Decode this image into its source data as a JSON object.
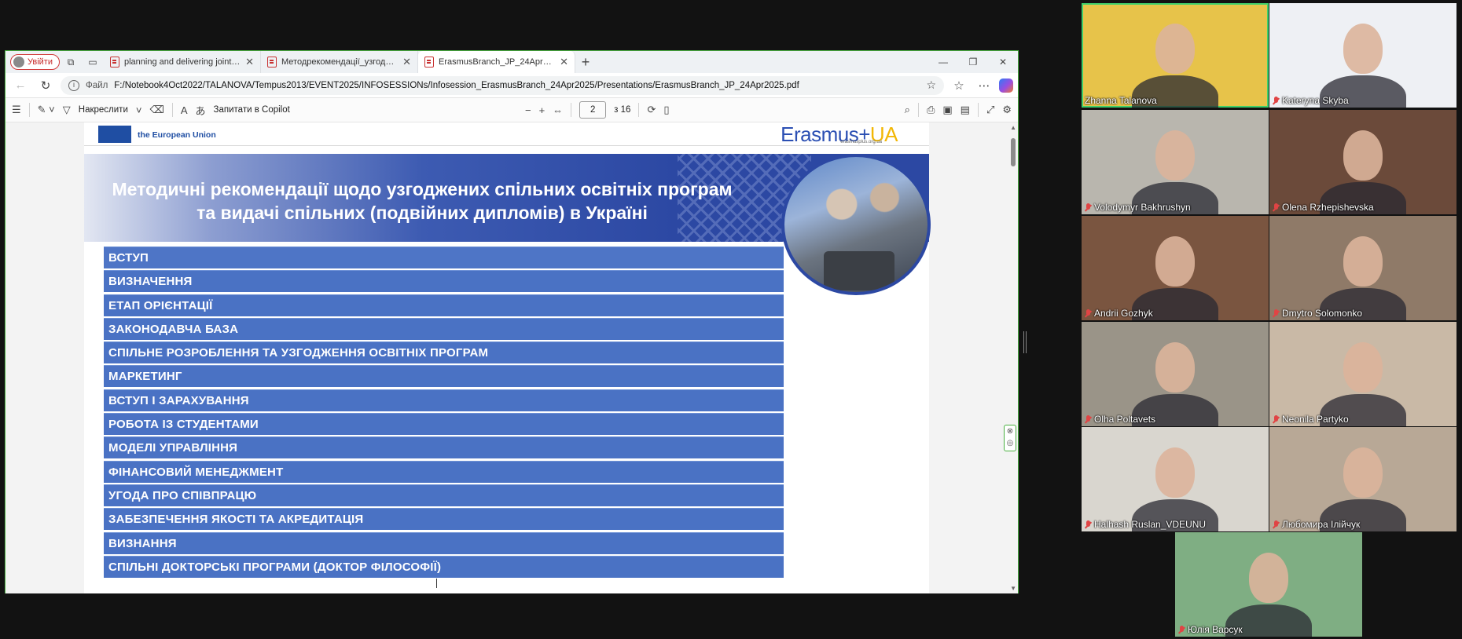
{
  "browser": {
    "profile_label": "Увійти",
    "tabs": [
      {
        "title": "planning and delivering jointness"
      },
      {
        "title": "Методрекомендації_узгоджені_"
      },
      {
        "title": "ErasmusBranch_JP_24Apr2025.pdf"
      }
    ],
    "address": {
      "scheme": "Файл",
      "url": "F:/Notebook4Oct2022/TALANOVA/Tempus2013/EVENT2025/INFOSESSIONs/Infosession_ErasmusBranch_24Apr2025/Presentations/ErasmusBranch_JP_24Apr2025.pdf"
    },
    "pdf_toolbar": {
      "draw_label": "Накреслити",
      "copilot_label": "Запитати в Copilot",
      "page_current": "2",
      "page_total": "з 16"
    }
  },
  "slide": {
    "eu_text": "the European Union",
    "logo_main": "Erasmus+",
    "logo_ua": "UA",
    "logo_url": "erasmusplus.org.ua",
    "title_line1": "Методичні рекомендації  щодо узгоджених спільних освітніх програм",
    "title_line2": "та видачі спільних (подвійних дипломів) в Україні",
    "items": [
      "ВСТУП",
      "ВИЗНАЧЕННЯ",
      "ЕТАП ОРІЄНТАЦІЇ",
      "ЗАКОНОДАВЧА БАЗА",
      "СПІЛЬНЕ РОЗРОБЛЕННЯ  ТА УЗГОДЖЕННЯ ОСВІТНІХ ПРОГРАМ",
      "МАРКЕТИНГ",
      "ВСТУП І ЗАРАХУВАННЯ",
      "РОБОТА ІЗ СТУДЕНТАМИ",
      "МОДЕЛІ УПРАВЛІННЯ",
      "ФІНАНСОВИЙ МЕНЕДЖМЕНТ",
      "УГОДА ПРО СПІВПРАЦЮ",
      "ЗАБЕЗПЕЧЕННЯ ЯКОСТІ ТА АКРЕДИТАЦІЯ",
      "ВИЗНАННЯ",
      "СПІЛЬНІ ДОКТОРСЬКІ ПРОГРАМИ (ДОКТОР ФІЛОСОФІЇ)"
    ]
  },
  "participants": [
    {
      "name": "Zhanna Talanova",
      "muted": false,
      "speaking": true,
      "bg": "#e7c34a"
    },
    {
      "name": "Kateryna Skyba",
      "muted": true,
      "speaking": false,
      "bg": "#eef0f4"
    },
    {
      "name": "Volodymyr Bakhrushyn",
      "muted": true,
      "speaking": false,
      "bg": "#b9b6ae"
    },
    {
      "name": "Olena Rzhepishevska",
      "muted": true,
      "speaking": false,
      "bg": "#6b4a3a"
    },
    {
      "name": "Andrii Gozhyk",
      "muted": true,
      "speaking": false,
      "bg": "#7a5540"
    },
    {
      "name": "Dmytro Solomonko",
      "muted": true,
      "speaking": false,
      "bg": "#8f7a68"
    },
    {
      "name": "Olha Poltavets",
      "muted": true,
      "speaking": false,
      "bg": "#9a9488"
    },
    {
      "name": "Neonila Partyko",
      "muted": true,
      "speaking": false,
      "bg": "#c9b9a6"
    },
    {
      "name": "Halhash Ruslan_VDEUNU",
      "muted": true,
      "speaking": false,
      "bg": "#d9d6cf"
    },
    {
      "name": "Любомира Ілійчук",
      "muted": true,
      "speaking": false,
      "bg": "#b8a896"
    },
    {
      "name": "Юлія Варсук",
      "muted": true,
      "speaking": false,
      "bg": "#7fae83"
    }
  ],
  "colors": {
    "toc_item": "#4a72c4",
    "banner": "#2c48a3",
    "speaking_outline": "#3fd06b",
    "muted_icon": "#e04444"
  }
}
